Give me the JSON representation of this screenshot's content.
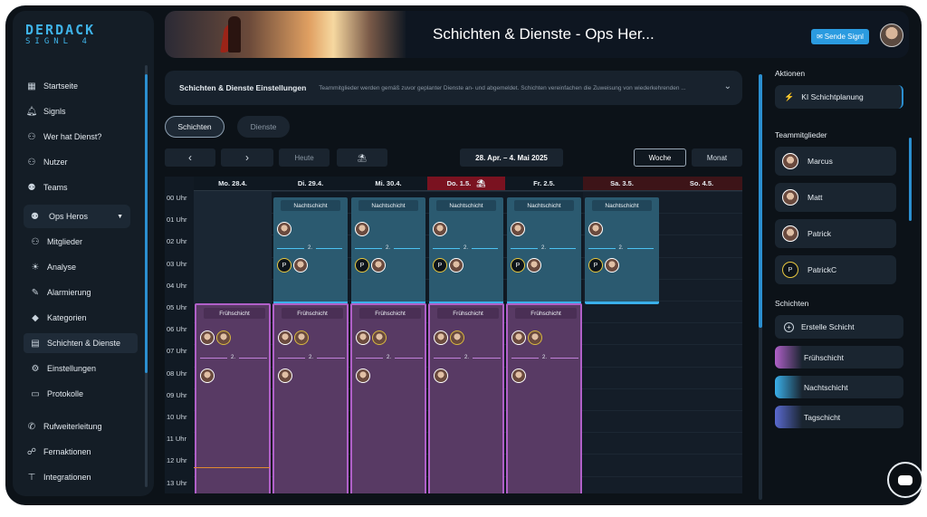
{
  "brand": {
    "line1": "DERDACK",
    "line2": "SIGNL 4"
  },
  "sidebar": {
    "items": [
      {
        "label": "Startseite",
        "icon": "grid-icon"
      },
      {
        "label": "Signls",
        "icon": "bell-icon"
      },
      {
        "label": "Wer hat Dienst?",
        "icon": "user-icon"
      },
      {
        "label": "Nutzer",
        "icon": "user-icon"
      },
      {
        "label": "Teams",
        "icon": "team-icon"
      }
    ],
    "group": {
      "label": "Ops Heros"
    },
    "group_items": [
      {
        "label": "Mitglieder",
        "icon": "members-icon"
      },
      {
        "label": "Analyse",
        "icon": "bulb-icon"
      },
      {
        "label": "Alarmierung",
        "icon": "wrench-icon"
      },
      {
        "label": "Kategorien",
        "icon": "category-icon"
      },
      {
        "label": "Schichten & Dienste",
        "icon": "calendar-icon"
      },
      {
        "label": "Einstellungen",
        "icon": "gear-icon"
      },
      {
        "label": "Protokolle",
        "icon": "document-icon"
      }
    ],
    "bottom_items": [
      {
        "label": "Rufweiterleitung",
        "icon": "phone-icon"
      },
      {
        "label": "Fernaktionen",
        "icon": "remote-icon"
      },
      {
        "label": "Integrationen",
        "icon": "plug-icon"
      }
    ]
  },
  "header": {
    "title": "Schichten & Dienste - Ops Her...",
    "send_button": "Sende Signl"
  },
  "settings": {
    "title": "Schichten & Dienste Einstellungen",
    "description": "Teammitglieder werden gemäß zuvor geplanter Dienste an- und abgemeldet. Schichten vereinfachen die Zuweisung von wiederkehrenden ..."
  },
  "tabs": {
    "shifts": "Schichten",
    "duties": "Dienste"
  },
  "toolbar": {
    "prev": "‹",
    "next": "›",
    "today": "Heute",
    "range": "28. Apr. – 4. Mai 2025",
    "week": "Woche",
    "month": "Monat"
  },
  "calendar": {
    "days": [
      "Mo. 28.4.",
      "Di. 29.4.",
      "Mi. 30.4.",
      "Do. 1.5.",
      "Fr. 2.5.",
      "Sa. 3.5.",
      "So. 4.5."
    ],
    "hours": [
      "00 Uhr",
      "01 Uhr",
      "02 Uhr",
      "03 Uhr",
      "04 Uhr",
      "05 Uhr",
      "06 Uhr",
      "07 Uhr",
      "08 Uhr",
      "09 Uhr",
      "10 Uhr",
      "11 Uhr",
      "12 Uhr",
      "13 Uhr"
    ],
    "night_label": "Nachtschicht",
    "early_label": "Frühschicht",
    "level_label": "2."
  },
  "right": {
    "actions_title": "Aktionen",
    "ai_button": "KI Schichtplanung",
    "members_title": "Teammitglieder",
    "members": [
      "Marcus",
      "Matt",
      "Patrick",
      "PatrickC"
    ],
    "shifts_title": "Schichten",
    "create_shift": "Erstelle Schicht",
    "shifts": [
      {
        "label": "Frühschicht",
        "color": "#b060c8"
      },
      {
        "label": "Nachtschicht",
        "color": "#3ab0ea"
      },
      {
        "label": "Tagschicht",
        "color": "#5a6ad0"
      }
    ]
  },
  "avatar_initial": "P"
}
